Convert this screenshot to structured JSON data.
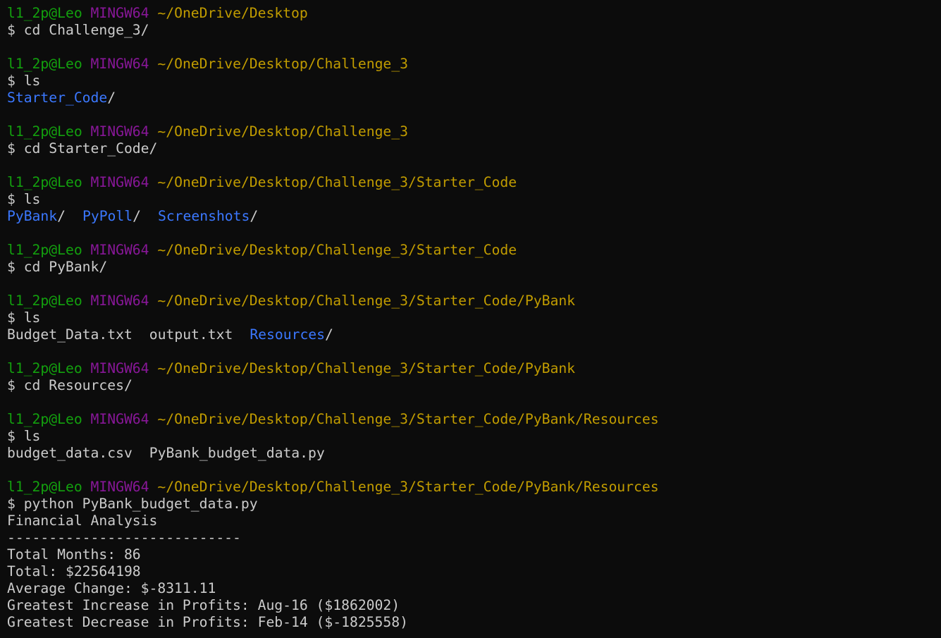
{
  "terminal": {
    "colors": {
      "background": "#0c0c0c",
      "text": "#cccccc",
      "user": "#13a10e",
      "host": "#881798",
      "path": "#c19c00",
      "directory": "#3b78ff"
    },
    "blocks": [
      {
        "prompt": {
          "user": "l1_2p@Leo",
          "host": "MINGW64",
          "path": "~/OneDrive/Desktop"
        },
        "command": "$ cd Challenge_3/",
        "output": []
      },
      {
        "prompt": {
          "user": "l1_2p@Leo",
          "host": "MINGW64",
          "path": "~/OneDrive/Desktop/Challenge_3"
        },
        "command": "$ ls",
        "output": [
          [
            {
              "text": "Starter_Code",
              "kind": "dir"
            },
            {
              "text": "/",
              "kind": "txt"
            }
          ]
        ]
      },
      {
        "prompt": {
          "user": "l1_2p@Leo",
          "host": "MINGW64",
          "path": "~/OneDrive/Desktop/Challenge_3"
        },
        "command": "$ cd Starter_Code/",
        "output": []
      },
      {
        "prompt": {
          "user": "l1_2p@Leo",
          "host": "MINGW64",
          "path": "~/OneDrive/Desktop/Challenge_3/Starter_Code"
        },
        "command": "$ ls",
        "output": [
          [
            {
              "text": "PyBank",
              "kind": "dir"
            },
            {
              "text": "/",
              "kind": "txt"
            },
            {
              "text": "",
              "kind": "gap"
            },
            {
              "text": "PyPoll",
              "kind": "dir"
            },
            {
              "text": "/",
              "kind": "txt"
            },
            {
              "text": "",
              "kind": "gap"
            },
            {
              "text": "Screenshots",
              "kind": "dir"
            },
            {
              "text": "/",
              "kind": "txt"
            }
          ]
        ]
      },
      {
        "prompt": {
          "user": "l1_2p@Leo",
          "host": "MINGW64",
          "path": "~/OneDrive/Desktop/Challenge_3/Starter_Code"
        },
        "command": "$ cd PyBank/",
        "output": []
      },
      {
        "prompt": {
          "user": "l1_2p@Leo",
          "host": "MINGW64",
          "path": "~/OneDrive/Desktop/Challenge_3/Starter_Code/PyBank"
        },
        "command": "$ ls",
        "output": [
          [
            {
              "text": "Budget_Data.txt",
              "kind": "txt"
            },
            {
              "text": "",
              "kind": "gap"
            },
            {
              "text": "output.txt",
              "kind": "txt"
            },
            {
              "text": "",
              "kind": "gap"
            },
            {
              "text": "Resources",
              "kind": "dir"
            },
            {
              "text": "/",
              "kind": "txt"
            }
          ]
        ]
      },
      {
        "prompt": {
          "user": "l1_2p@Leo",
          "host": "MINGW64",
          "path": "~/OneDrive/Desktop/Challenge_3/Starter_Code/PyBank"
        },
        "command": "$ cd Resources/",
        "output": []
      },
      {
        "prompt": {
          "user": "l1_2p@Leo",
          "host": "MINGW64",
          "path": "~/OneDrive/Desktop/Challenge_3/Starter_Code/PyBank/Resources"
        },
        "command": "$ ls",
        "output": [
          [
            {
              "text": "budget_data.csv",
              "kind": "txt"
            },
            {
              "text": "",
              "kind": "gap"
            },
            {
              "text": "PyBank_budget_data.py",
              "kind": "txt"
            }
          ]
        ]
      },
      {
        "prompt": {
          "user": "l1_2p@Leo",
          "host": "MINGW64",
          "path": "~/OneDrive/Desktop/Challenge_3/Starter_Code/PyBank/Resources"
        },
        "command": "$ python PyBank_budget_data.py",
        "output": [
          [
            {
              "text": "Financial Analysis",
              "kind": "txt"
            }
          ],
          [
            {
              "text": "----------------------------",
              "kind": "txt"
            }
          ],
          [
            {
              "text": "Total Months: 86",
              "kind": "txt"
            }
          ],
          [
            {
              "text": "Total: $22564198",
              "kind": "txt"
            }
          ],
          [
            {
              "text": "Average Change: $-8311.11",
              "kind": "txt"
            }
          ],
          [
            {
              "text": "Greatest Increase in Profits: Aug-16 ($1862002)",
              "kind": "txt"
            }
          ],
          [
            {
              "text": "Greatest Decrease in Profits: Feb-14 ($-1825558)",
              "kind": "txt"
            }
          ]
        ]
      }
    ]
  }
}
